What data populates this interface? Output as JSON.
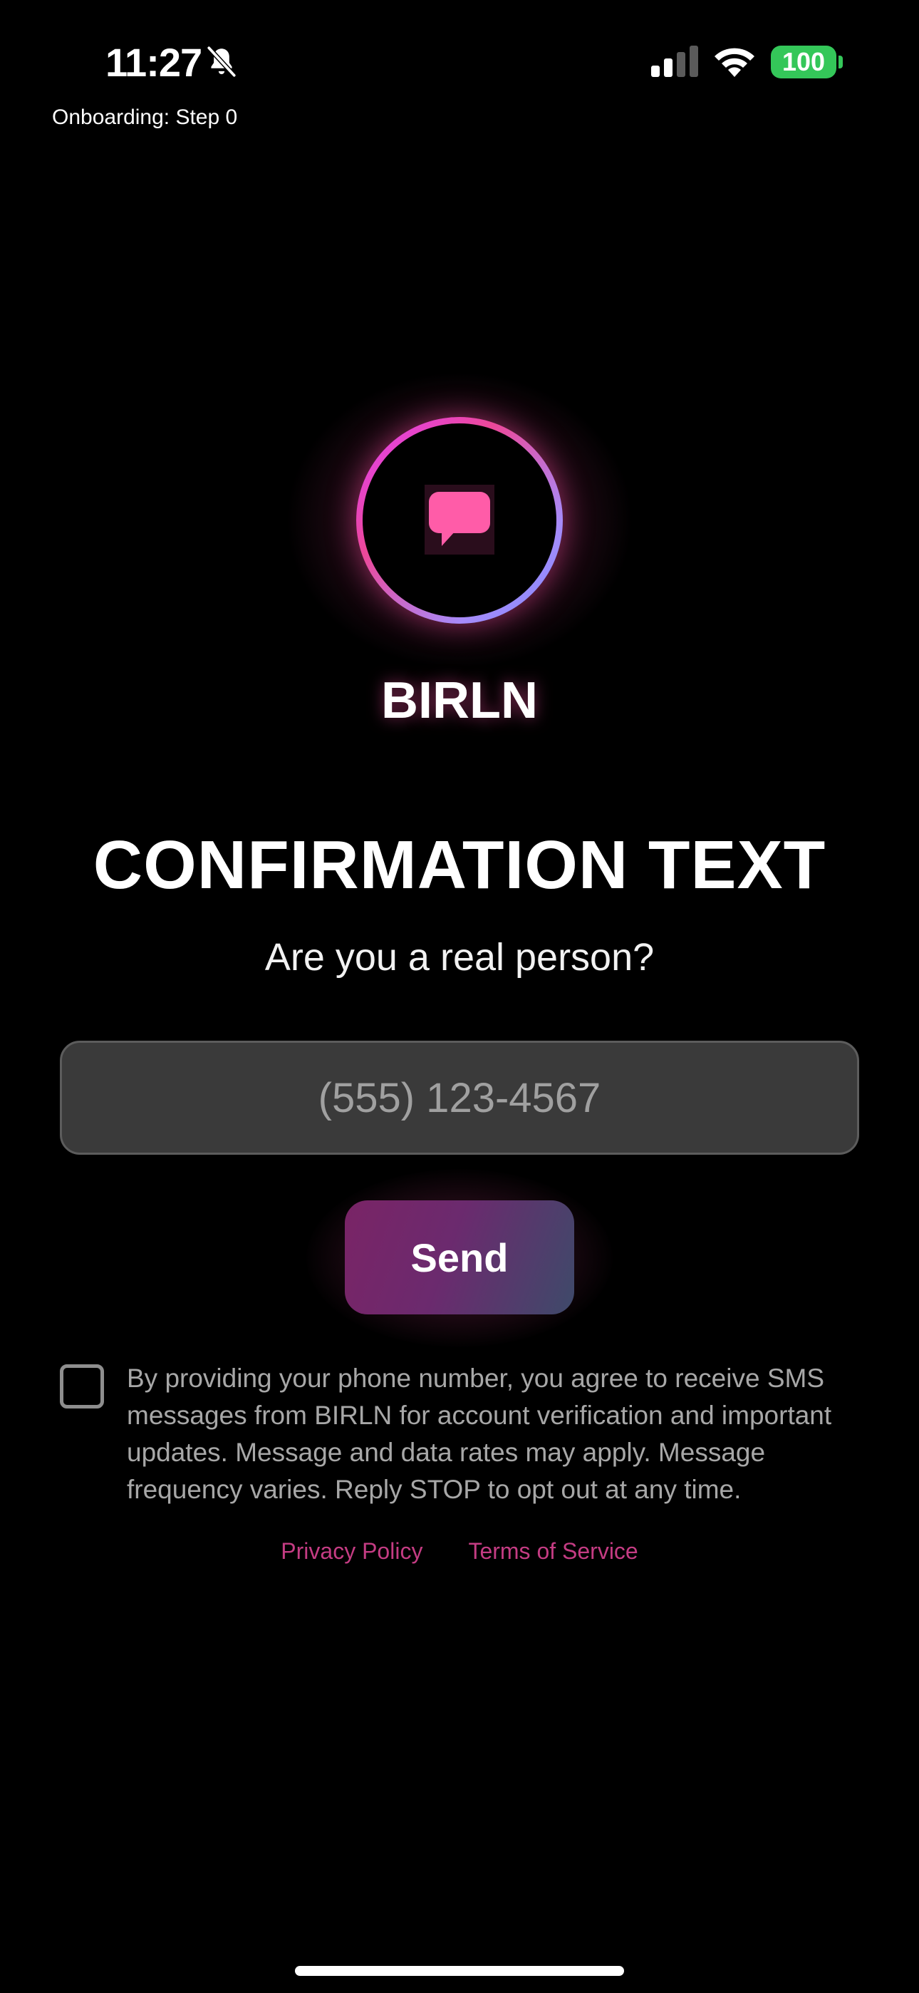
{
  "status_bar": {
    "time": "11:27",
    "battery": "100",
    "icons": [
      "bell-slash-icon",
      "cellular-signal-icon",
      "wifi-icon",
      "battery-icon"
    ]
  },
  "debug_label": "Onboarding: Step 0",
  "logo": {
    "icon": "chat-bubble-icon",
    "brand": "BIRLN"
  },
  "heading": {
    "title": "CONFIRMATION TEXT",
    "subtitle": "Are you a real person?"
  },
  "phone_input": {
    "value": "",
    "placeholder": "(555) 123-4567"
  },
  "send_button": {
    "label": "Send"
  },
  "consent": {
    "checked": false,
    "text": "By providing your phone number, you agree to receive SMS messages from BIRLN for account verification and important updates. Message and data rates may apply. Message frequency varies. Reply STOP to opt out at any time."
  },
  "links": {
    "privacy": "Privacy Policy",
    "terms": "Terms of Service"
  },
  "colors": {
    "background": "#000000",
    "accent_pink": "#ec4899",
    "accent_purple": "#a78bfa",
    "link": "#c43c83",
    "battery_green": "#34c759",
    "input_bg": "#3a3a3a"
  }
}
